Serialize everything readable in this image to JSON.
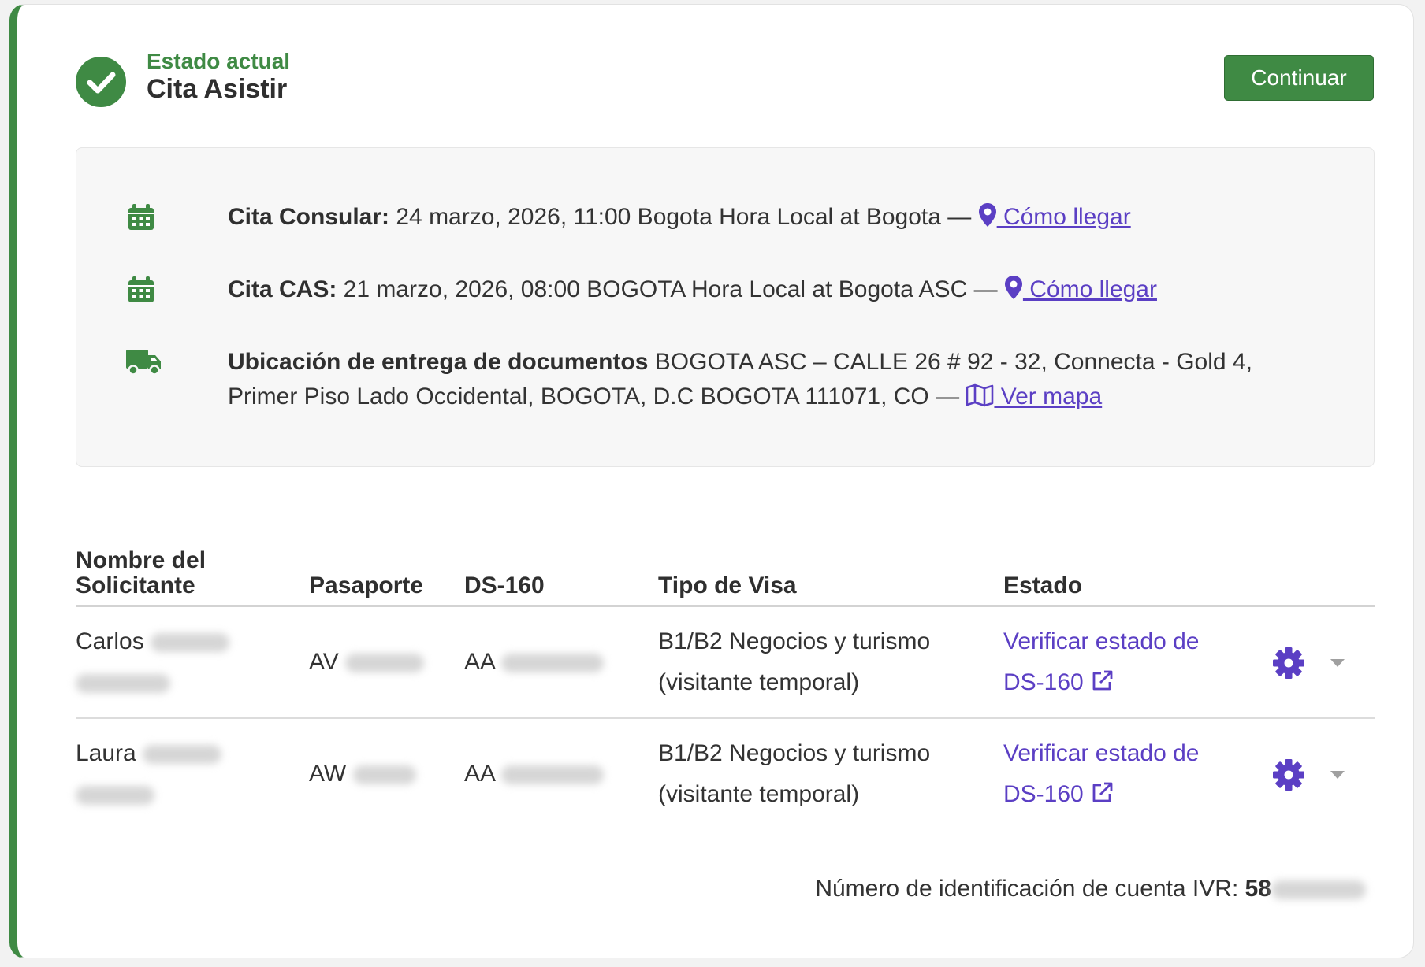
{
  "status": {
    "label": "Estado actual",
    "value": "Cita Asistir",
    "continue_button": "Continuar"
  },
  "appointments": {
    "consular": {
      "label": "Cita Consular:",
      "text": " 24 marzo, 2026, 11:00 Bogota Hora Local at Bogota — ",
      "link": " Cómo llegar"
    },
    "cas": {
      "label": "Cita CAS:",
      "text": " 21 marzo, 2026, 08:00 BOGOTA Hora Local at Bogota ASC — ",
      "link": " Cómo llegar"
    },
    "delivery": {
      "label": "Ubicación de entrega de documentos",
      "line1": " BOGOTA ASC – CALLE 26 # 92 - 32, Connecta - Gold 4,",
      "line2": "Primer Piso Lado Occidental, BOGOTA, D.C BOGOTA 111071, CO — ",
      "link": " Ver mapa"
    }
  },
  "table": {
    "headers": {
      "name_line1": "Nombre del",
      "name_line2": "Solicitante",
      "passport": "Pasaporte",
      "ds160": "DS-160",
      "visa_type": "Tipo de Visa",
      "status": "Estado"
    },
    "rows": [
      {
        "first_name": "Carlos",
        "passport_prefix": "AV",
        "ds160_prefix": "AA",
        "visa_line1": "B1/B2 Negocios y turismo",
        "visa_line2": "(visitante temporal)",
        "status_line1": "Verificar estado de",
        "status_line2": "DS-160"
      },
      {
        "first_name": "Laura",
        "passport_prefix": "AW",
        "ds160_prefix": "AA",
        "visa_line1": "B1/B2 Negocios y turismo",
        "visa_line2": "(visitante temporal)",
        "status_line1": "Verificar estado de",
        "status_line2": "DS-160"
      }
    ]
  },
  "ivr": {
    "label": "Número de identificación de cuenta IVR: ",
    "value_prefix": "58"
  },
  "colors": {
    "accent_green": "#3f8a44",
    "link_purple": "#5b3fc4"
  },
  "icons": {
    "status": "check-circle-icon",
    "appointment": "calendar-icon",
    "delivery": "truck-icon",
    "directions": "map-pin-icon",
    "map": "map-icon",
    "external": "external-link-icon",
    "actions": "gear-icon",
    "dropdown": "caret-down-icon"
  }
}
